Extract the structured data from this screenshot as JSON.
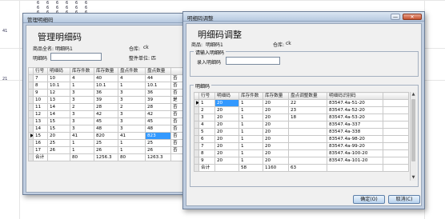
{
  "background": {
    "row_numbers": [
      "41",
      "21"
    ],
    "cells": [
      "6",
      "6",
      "6",
      "6",
      "6",
      "6",
      "6",
      "6",
      "6",
      "6",
      "6",
      "6",
      "6",
      "6",
      "6",
      "6",
      "6",
      "6"
    ]
  },
  "left_window": {
    "title": "管理明细码",
    "heading": "管理明细码",
    "product_label": "商品全名:",
    "product_value": "明细码1",
    "warehouse_label": "仓库:",
    "warehouse_value": "ck",
    "code_label": "明细码",
    "code_value": "",
    "unit_label": "整件单位:",
    "unit_value": "匹",
    "columns": [
      "行号",
      "明细码",
      "库存件数",
      "库存数量",
      "盘点件数",
      "盘点数量"
    ],
    "rows": [
      [
        "7",
        "10",
        "4",
        "40",
        "4",
        "44",
        "否"
      ],
      [
        "8",
        "10.1",
        "1",
        "10.1",
        "1",
        "10.1",
        "否"
      ],
      [
        "9",
        "12",
        "3",
        "36",
        "3",
        "36",
        "否"
      ],
      [
        "10",
        "13",
        "3",
        "39",
        "3",
        "39",
        "是"
      ],
      [
        "11",
        "14",
        "2",
        "28",
        "2",
        "28",
        "否"
      ],
      [
        "12",
        "14",
        "3",
        "42",
        "3",
        "42",
        "否"
      ],
      [
        "13",
        "15",
        "3",
        "45",
        "3",
        "45",
        "否"
      ],
      [
        "14",
        "15",
        "3",
        "48",
        "3",
        "48",
        "否"
      ],
      [
        "15",
        "20",
        "41",
        "820",
        "41",
        "823",
        "否"
      ],
      [
        "16",
        "25",
        "1",
        "25",
        "1",
        "25",
        "否"
      ],
      [
        "17",
        "26",
        "1",
        "26",
        "1",
        "26",
        "否"
      ]
    ],
    "total_row": [
      "合计",
      "",
      "80",
      "1256.3",
      "80",
      "1263.3",
      ""
    ]
  },
  "right_window": {
    "title": "明细码调整",
    "heading": "明细码调整",
    "product_label": "商品:",
    "product_value": "明细码1",
    "warehouse_label": "仓库:",
    "warehouse_value": "ck",
    "input_group_label": "请输入明细码",
    "input_label": "录入明细码",
    "input_value": "",
    "list_group_label": "明细码",
    "columns": [
      "行号",
      "明细码",
      "库存件数",
      "库存数量",
      "盘点调整数量",
      "明细码识别码"
    ],
    "rows": [
      [
        "1",
        "20",
        "1",
        "20",
        "22",
        "83547.4a-51-20"
      ],
      [
        "2",
        "20",
        "1",
        "20",
        "23",
        "83547.4a-52-20"
      ],
      [
        "3",
        "20",
        "1",
        "20",
        "18",
        "83547.4a-53-20"
      ],
      [
        "4",
        "20",
        "1",
        "20",
        "",
        "83547.4a-337"
      ],
      [
        "5",
        "20",
        "1",
        "20",
        "",
        "83547.4a-338"
      ],
      [
        "6",
        "20",
        "1",
        "20",
        "",
        "83547.4a-98-20"
      ],
      [
        "7",
        "20",
        "1",
        "20",
        "",
        "83547.4a-99-20"
      ],
      [
        "8",
        "20",
        "1",
        "20",
        "",
        "83547.4a-100-20"
      ],
      [
        "9",
        "20",
        "1",
        "20",
        "",
        "83547.4a-101-20"
      ]
    ],
    "total_row": [
      "合计",
      "",
      "58",
      "1160",
      "63",
      ""
    ],
    "ok_label": "确定(O)",
    "cancel_label": "取消(C)"
  },
  "controls": {
    "minimize": "—",
    "maximize": "□",
    "close": "✕"
  },
  "icons": {
    "row_indicator": "▶",
    "scroll_up": "▲",
    "scroll_down": "▼"
  }
}
